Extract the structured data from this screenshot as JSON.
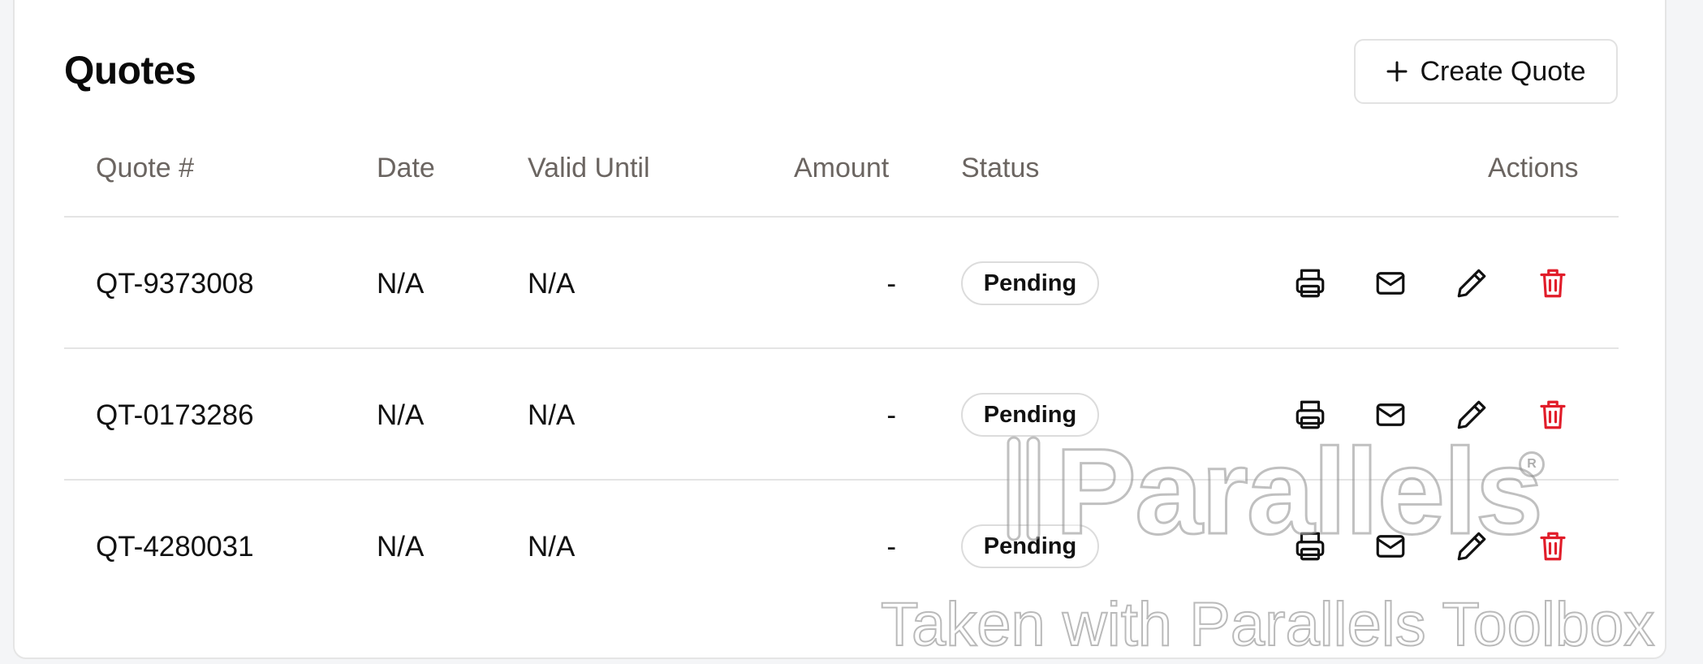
{
  "header": {
    "title": "Quotes",
    "create_button_label": "Create Quote"
  },
  "table": {
    "columns": [
      "Quote #",
      "Date",
      "Valid Until",
      "Amount",
      "Status",
      "Actions"
    ],
    "rows": [
      {
        "quote_no": "QT-9373008",
        "date": "N/A",
        "valid_until": "N/A",
        "amount": "-",
        "status": "Pending"
      },
      {
        "quote_no": "QT-0173286",
        "date": "N/A",
        "valid_until": "N/A",
        "amount": "-",
        "status": "Pending"
      },
      {
        "quote_no": "QT-4280031",
        "date": "N/A",
        "valid_until": "N/A",
        "amount": "-",
        "status": "Pending"
      }
    ],
    "row_actions": [
      "printer-icon",
      "mail-icon",
      "pencil-icon",
      "trash-icon"
    ]
  },
  "colors": {
    "delete": "#e11d2a",
    "header_text": "#6b6561",
    "border": "#e4e4e4"
  },
  "watermark": {
    "logo": "Parallels",
    "text": "Taken with Parallels Toolbox"
  }
}
